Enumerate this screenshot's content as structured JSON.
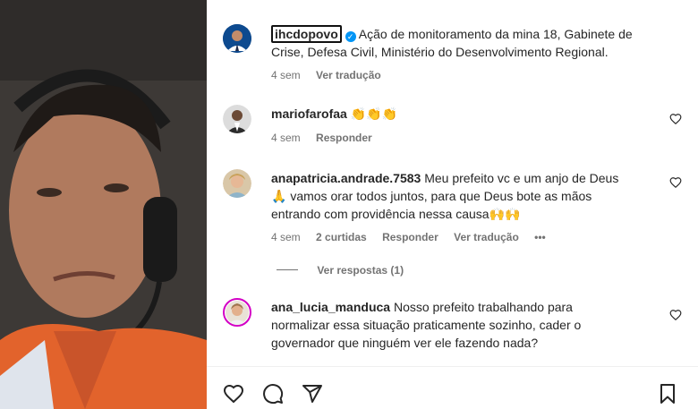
{
  "post": {
    "author": "ihcdopovo",
    "verified": true,
    "caption_line1": "Ação de monitoramento da mina 18, Gabinete de",
    "caption_line2": "Crise, Defesa Civil, Ministério do Desenvolvimento Regional.",
    "time": "4 sem",
    "see_translation": "Ver tradução"
  },
  "comments": [
    {
      "user": "mariofarofaa",
      "text": "👏👏👏",
      "time": "4 sem",
      "reply": "Responder"
    },
    {
      "user": "anapatricia.andrade.7583",
      "text_line1": "Meu prefeito vc e um anjo de Deus",
      "text_line2": "🙏 vamos orar todos juntos, para que Deus bote as mãos",
      "text_line3": "entrando com providência nessa causa🙌🙌",
      "time": "4 sem",
      "likes": "2 curtidas",
      "reply": "Responder",
      "see_translation": "Ver tradução",
      "more": "•••",
      "view_replies": "Ver respostas (1)"
    },
    {
      "user": "ana_lucia_manduca",
      "text_line1": "Nosso prefeito trabalhando para",
      "text_line2": "normalizar essa situação praticamente sozinho, cader o",
      "text_line3": "governador que ninguém ver ele fazendo nada?"
    }
  ],
  "icons": {
    "like": "heart-icon",
    "comment": "comment-icon",
    "share": "send-icon",
    "save": "bookmark-icon"
  },
  "colors": {
    "verified": "#0095f6",
    "meta": "#737373",
    "text": "#262626"
  }
}
